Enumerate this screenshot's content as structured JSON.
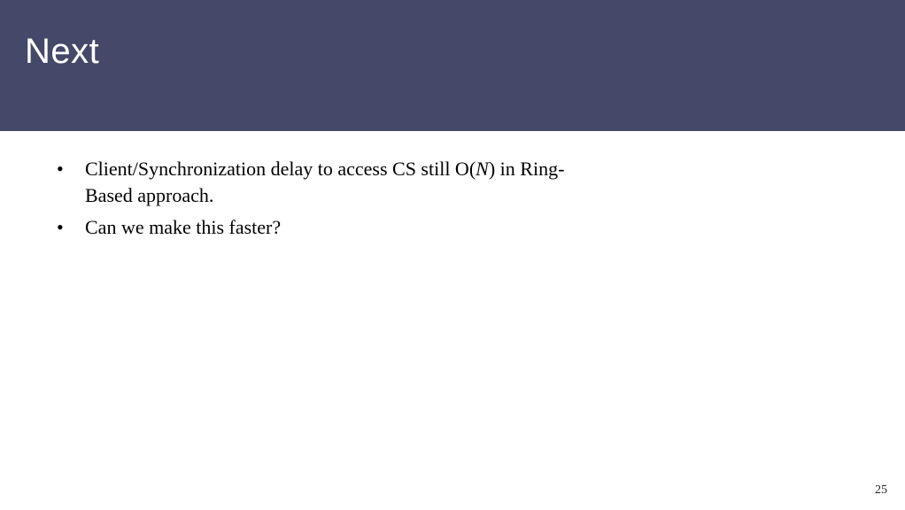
{
  "header": {
    "title": "Next"
  },
  "body": {
    "items": [
      {
        "pre": "Client/Synchronization delay to access CS still O(",
        "var": "N",
        "post": ") in Ring-Based approach."
      },
      {
        "text": "Can we make this faster?"
      }
    ]
  },
  "footer": {
    "page": "25"
  }
}
